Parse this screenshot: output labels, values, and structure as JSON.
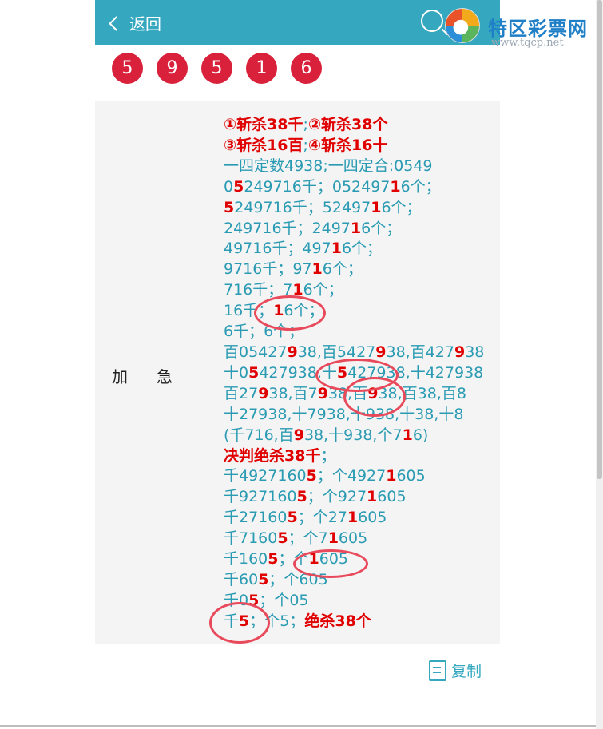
{
  "header": {
    "back_label": "返回",
    "logo_text": "特区彩票网",
    "logo_url": "www.tqcp.net",
    "bg_color": "#35a8c0"
  },
  "balls": [
    "5",
    "9",
    "5",
    "1",
    "6"
  ],
  "panel": {
    "side_label": "加急",
    "lines": [
      [
        {
          "t": "①斩杀38千",
          "r": true
        },
        {
          "t": ";"
        },
        {
          "t": "②斩杀38个",
          "r": true
        }
      ],
      [
        {
          "t": "③斩杀16百",
          "r": true
        },
        {
          "t": ";"
        },
        {
          "t": "④斩杀16十",
          "r": true
        }
      ],
      [
        {
          "t": "一四定数4938;一四定合:0549"
        }
      ],
      [
        {
          "t": "0"
        },
        {
          "t": "5",
          "r": true
        },
        {
          "t": "249716千；052497"
        },
        {
          "t": "1",
          "r": true
        },
        {
          "t": "6个；"
        }
      ],
      [
        {
          "t": "5",
          "r": true
        },
        {
          "t": "249716千；52497"
        },
        {
          "t": "1",
          "r": true
        },
        {
          "t": "6个；"
        }
      ],
      [
        {
          "t": "249716千；2497"
        },
        {
          "t": "1",
          "r": true
        },
        {
          "t": "6个；"
        }
      ],
      [
        {
          "t": "49716千；497"
        },
        {
          "t": "1",
          "r": true
        },
        {
          "t": "6个；"
        }
      ],
      [
        {
          "t": "9716千；97"
        },
        {
          "t": "1",
          "r": true
        },
        {
          "t": "6个；"
        }
      ],
      [
        {
          "t": "716千；7"
        },
        {
          "t": "1",
          "r": true
        },
        {
          "t": "6个；"
        }
      ],
      [
        {
          "t": "16千；"
        },
        {
          "t": "1",
          "r": true
        },
        {
          "t": "6个；"
        }
      ],
      [
        {
          "t": "6千；6个；"
        }
      ],
      [
        {
          "t": "百05427"
        },
        {
          "t": "9",
          "r": true
        },
        {
          "t": "38,百5427"
        },
        {
          "t": "9",
          "r": true
        },
        {
          "t": "38,百427"
        },
        {
          "t": "9",
          "r": true
        },
        {
          "t": "38"
        }
      ],
      [
        {
          "t": "十0"
        },
        {
          "t": "5",
          "r": true
        },
        {
          "t": "427938,十"
        },
        {
          "t": "5",
          "r": true
        },
        {
          "t": "427938,十427938"
        }
      ],
      [
        {
          "t": "百27"
        },
        {
          "t": "9",
          "r": true
        },
        {
          "t": "38,百7"
        },
        {
          "t": "9",
          "r": true
        },
        {
          "t": "38,百"
        },
        {
          "t": "9",
          "r": true
        },
        {
          "t": "38,百38,百8"
        }
      ],
      [
        {
          "t": "十27938,十7938,十938,十38,十8"
        }
      ],
      [
        {
          "t": "(千716,百"
        },
        {
          "t": "9",
          "r": true
        },
        {
          "t": "38,十938,个7"
        },
        {
          "t": "1",
          "r": true
        },
        {
          "t": "6)"
        }
      ],
      [
        {
          "t": "决判绝杀38千",
          "r": true
        },
        {
          "t": "；"
        }
      ],
      [
        {
          "t": "千4927160"
        },
        {
          "t": "5",
          "r": true
        },
        {
          "t": "；个4927"
        },
        {
          "t": "1",
          "r": true
        },
        {
          "t": "605"
        }
      ],
      [
        {
          "t": "千927160"
        },
        {
          "t": "5",
          "r": true
        },
        {
          "t": "；个927"
        },
        {
          "t": "1",
          "r": true
        },
        {
          "t": "605"
        }
      ],
      [
        {
          "t": "千27160"
        },
        {
          "t": "5",
          "r": true
        },
        {
          "t": "；个27"
        },
        {
          "t": "1",
          "r": true
        },
        {
          "t": "605"
        }
      ],
      [
        {
          "t": "千7160"
        },
        {
          "t": "5",
          "r": true
        },
        {
          "t": "；个7"
        },
        {
          "t": "1",
          "r": true
        },
        {
          "t": "605"
        }
      ],
      [
        {
          "t": "千160"
        },
        {
          "t": "5",
          "r": true
        },
        {
          "t": "；个"
        },
        {
          "t": "1",
          "r": true
        },
        {
          "t": "605"
        }
      ],
      [
        {
          "t": "千60"
        },
        {
          "t": "5",
          "r": true
        },
        {
          "t": "；个605"
        }
      ],
      [
        {
          "t": "千0"
        },
        {
          "t": "5",
          "r": true
        },
        {
          "t": "；个05"
        }
      ],
      [
        {
          "t": "千"
        },
        {
          "t": "5",
          "r": true
        },
        {
          "t": "；个5；"
        },
        {
          "t": "绝杀38个",
          "r": true
        }
      ]
    ]
  },
  "copy_label": "复制"
}
